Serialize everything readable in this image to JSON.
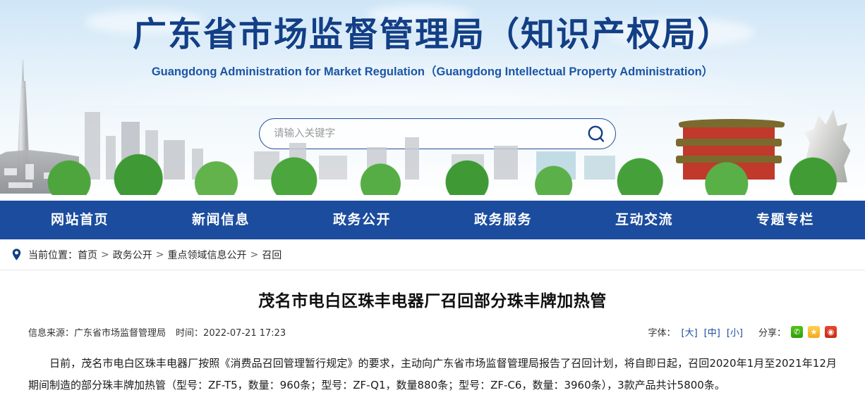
{
  "header": {
    "title_cn": "广东省市场监督管理局（知识产权局）",
    "title_en": "Guangdong Administration for Market Regulation（Guangdong Intellectual Property Administration）",
    "search": {
      "placeholder": "请输入关键字",
      "value": "",
      "icon": "search-icon"
    },
    "accent_color": "#123f86"
  },
  "nav": {
    "background": "#1b4c9e",
    "items": [
      {
        "label": "网站首页"
      },
      {
        "label": "新闻信息"
      },
      {
        "label": "政务公开"
      },
      {
        "label": "政务服务"
      },
      {
        "label": "互动交流"
      },
      {
        "label": "专题专栏"
      }
    ]
  },
  "breadcrumb": {
    "icon": "location-pin-icon",
    "label": "当前位置：",
    "items": [
      "首页",
      "政务公开",
      "重点领域信息公开",
      "召回"
    ],
    "separator": ">"
  },
  "article": {
    "title": "茂名市电白区珠丰电器厂召回部分珠丰牌加热管",
    "source_label": "信息来源：",
    "source_value": "广东省市场监督管理局",
    "time_label": "时间：",
    "time_value": "2022-07-21 17:23",
    "fontsize_label": "字体：",
    "fontsize_options": [
      "[大]",
      "[中]",
      "[小]"
    ],
    "share_label": "分享：",
    "share_icons": [
      {
        "name": "wechat-share-icon",
        "glyph": "✆",
        "color": "#2f9e0a"
      },
      {
        "name": "qzone-share-icon",
        "glyph": "★",
        "color": "#f5a623"
      },
      {
        "name": "weibo-share-icon",
        "glyph": "◉",
        "color": "#c22d18"
      }
    ],
    "body": "日前，茂名市电白区珠丰电器厂按照《消费品召回管理暂行规定》的要求，主动向广东省市场监督管理局报告了召回计划，将自即日起，召回2020年1月至2021年12月期间制造的部分珠丰牌加热管（型号：ZF-T5，数量：960条；型号：ZF-Q1，数量880条；型号：ZF-C6，数量：3960条），3款产品共计5800条。"
  }
}
